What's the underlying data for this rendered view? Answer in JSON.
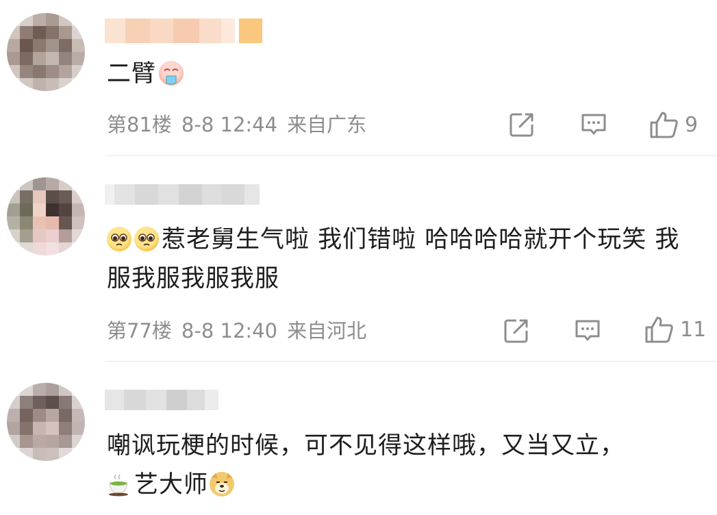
{
  "comments": [
    {
      "text": "二臂",
      "floor": "第81楼",
      "time": "8-8 12:44",
      "location": "来自广东",
      "likes": "9",
      "emoji_prefix": [],
      "emoji_suffix": [
        "drooling-face-emoji"
      ]
    },
    {
      "text": "惹老舅生气啦 我们错啦 哈哈哈哈就开个玩笑 我服我服我服我服",
      "floor": "第77楼",
      "time": "8-8 12:40",
      "location": "来自河北",
      "likes": "11",
      "emoji_prefix": [
        "pleading-face-emoji",
        "pleading-face-emoji"
      ],
      "emoji_suffix": []
    },
    {
      "text_line1": "嘲讽玩梗的时候，可不见得这样哦，又当又立，",
      "text_line2": "艺大师",
      "emoji_line2_prefix": [
        "tea-emoji"
      ],
      "emoji_line2_suffix": [
        "doge-emoji"
      ]
    }
  ],
  "icons": {
    "share": "share-icon",
    "comment": "comment-icon",
    "like": "thumbs-up-icon"
  },
  "colors": {
    "text": "#1d1d1d",
    "meta": "#8d8d8d",
    "divider": "#e6e6e6",
    "icon": "#8d8d8d"
  }
}
